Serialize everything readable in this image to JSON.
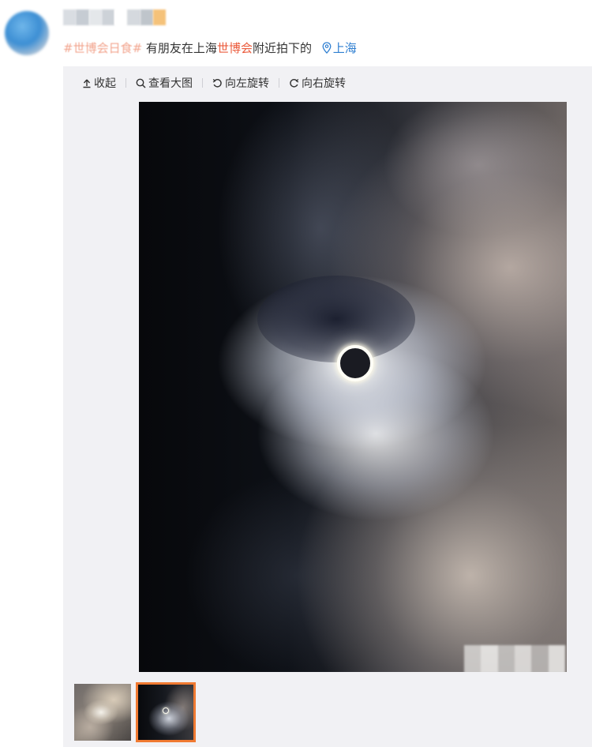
{
  "post": {
    "text_prefix": "有朋友在上海",
    "keyword": "世博会",
    "text_suffix": "附近拍下的",
    "hashtag": "#世博会日食#",
    "location": "上海"
  },
  "toolbar": {
    "collapse_label": "收起",
    "view_large_label": "查看大图",
    "rotate_left_label": "向左旋转",
    "rotate_right_label": "向右旋转"
  },
  "colors": {
    "keyword": "#eb5b3c",
    "location_link": "#2f7fd1",
    "thumb_selected": "#f07a32",
    "panel_bg": "#f1f1f4"
  },
  "icons": [
    "collapse-icon",
    "zoom-icon",
    "rotate-left-icon",
    "rotate-right-icon",
    "location-pin-icon"
  ],
  "thumbnails": {
    "count_shown": 2,
    "selected_index": 1
  }
}
